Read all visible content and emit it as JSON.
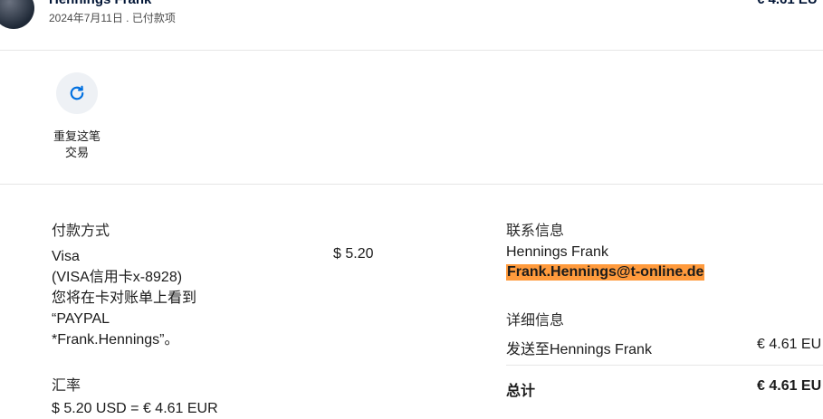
{
  "header": {
    "merchant_name": "Hennings Frank",
    "meta": "2024年7月11日 . 已付款项",
    "amount": "€ 4.61 EU"
  },
  "actions": {
    "repeat_label_line1": "重复这笔",
    "repeat_label_line2": "交易"
  },
  "payment_method": {
    "title": "付款方式",
    "lines": [
      "Visa",
      "(VISA信用卡x-8928)",
      "您将在卡对账单上看到",
      "“PAYPAL",
      "*Frank.Hennings”。"
    ],
    "amount": "$ 5.20"
  },
  "exchange_rate": {
    "title": "汇率",
    "value": "$ 5.20 USD = € 4.61 EUR"
  },
  "contact": {
    "title": "联系信息",
    "name": "Hennings Frank",
    "email": "Frank.Hennings@t-online.de"
  },
  "details": {
    "title": "详细信息",
    "sent_to_label": "发送至Hennings Frank",
    "sent_to_amount": "€ 4.61 EU",
    "total_label": "总计",
    "total_amount": "€ 4.61 EU"
  },
  "colors": {
    "accent": "#0070e0",
    "highlight": "#ff9a3c",
    "heading": "#001435"
  },
  "icons": {
    "repeat": "refresh-icon"
  }
}
